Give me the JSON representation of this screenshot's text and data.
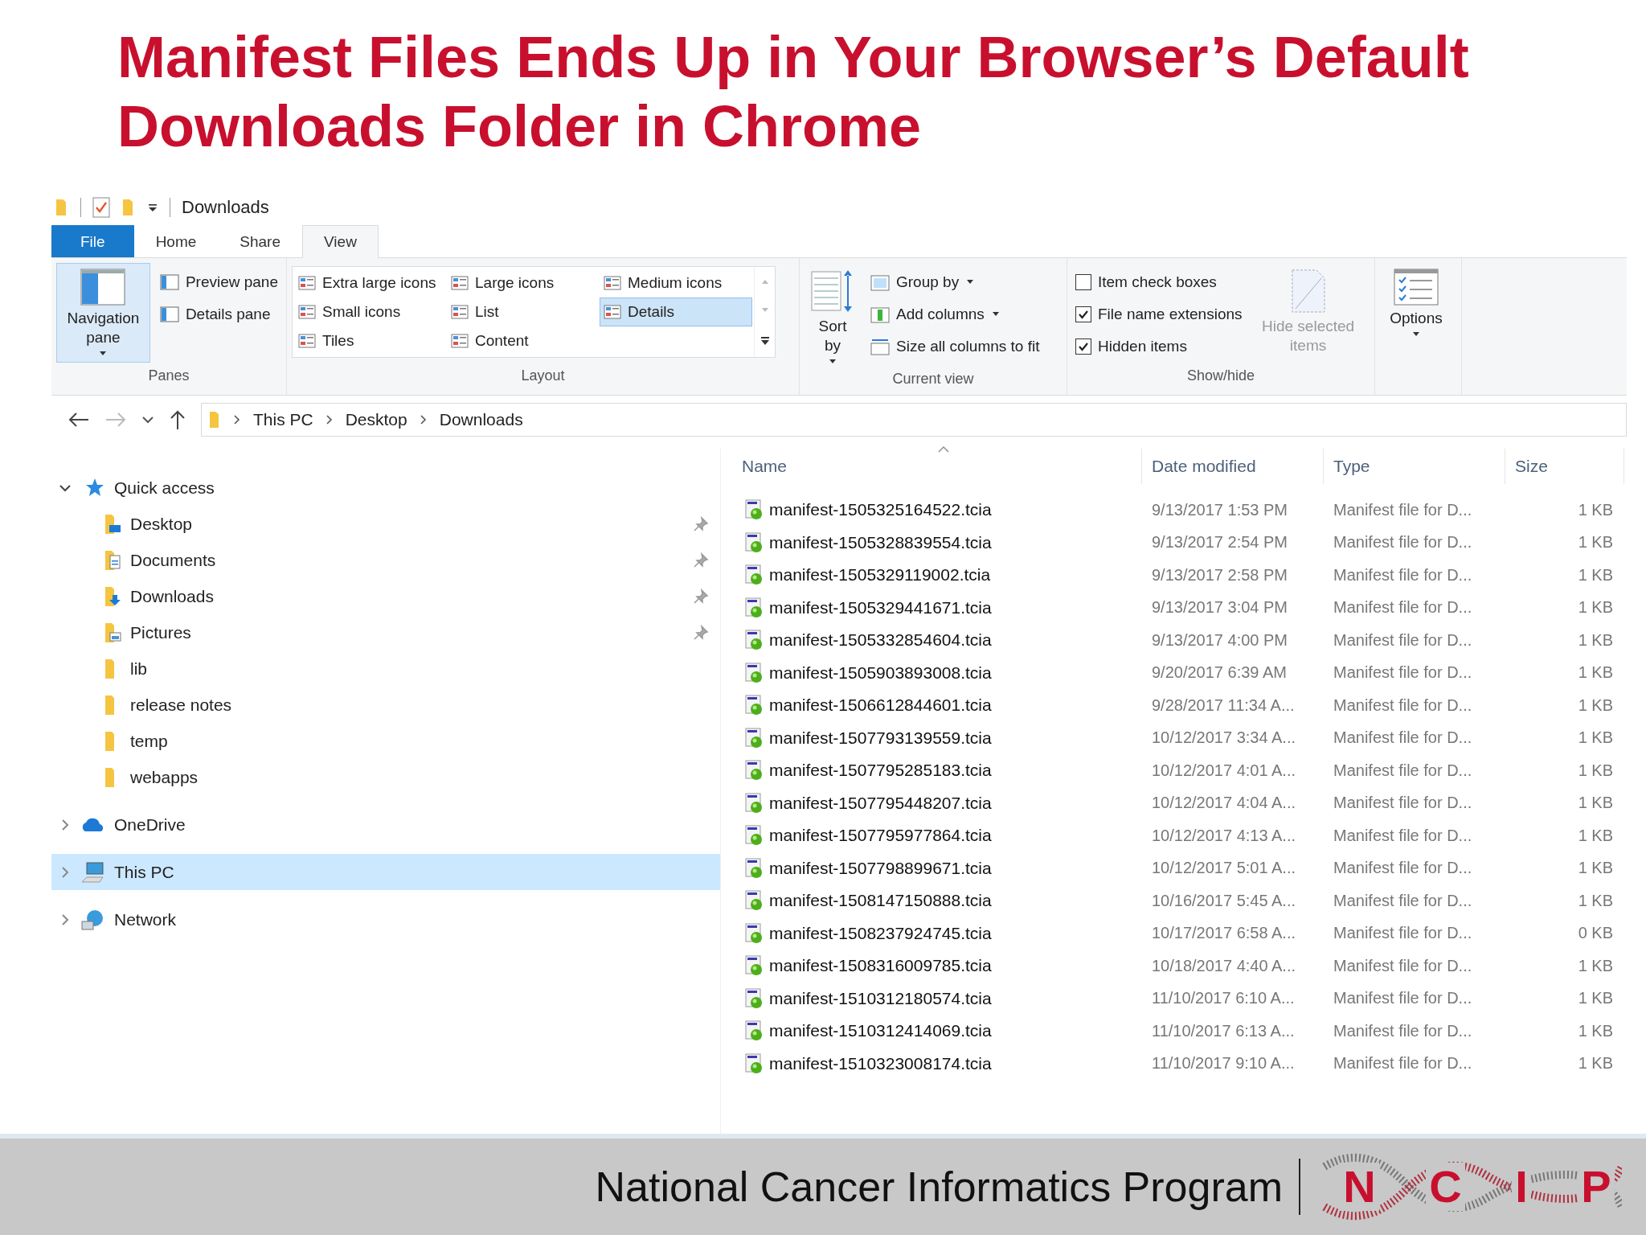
{
  "slide_title": "Manifest Files Ends Up in Your Browser’s Default Downloads Folder in Chrome",
  "window": {
    "title": "Downloads"
  },
  "ribbon_tabs": [
    {
      "label": "File",
      "kind": "file",
      "selected": false
    },
    {
      "label": "Home",
      "kind": "tab",
      "selected": false
    },
    {
      "label": "Share",
      "kind": "tab",
      "selected": false
    },
    {
      "label": "View",
      "kind": "tab",
      "selected": true
    }
  ],
  "panes_group": {
    "label": "Panes",
    "navigation_pane": {
      "label": "Navigation pane",
      "on": true
    },
    "items": [
      "Preview pane",
      "Details pane"
    ]
  },
  "layout_group": {
    "label": "Layout",
    "options": [
      {
        "label": "Extra large icons",
        "selected": false
      },
      {
        "label": "Large icons",
        "selected": false
      },
      {
        "label": "Medium icons",
        "selected": false
      },
      {
        "label": "Small icons",
        "selected": false
      },
      {
        "label": "List",
        "selected": false
      },
      {
        "label": "Details",
        "selected": true
      },
      {
        "label": "Tiles",
        "selected": false
      },
      {
        "label": "Content",
        "selected": false
      }
    ]
  },
  "current_view_group": {
    "label": "Current view",
    "sort_by": "Sort by",
    "items": [
      {
        "label": "Group by",
        "dropdown": true
      },
      {
        "label": "Add columns",
        "dropdown": true
      },
      {
        "label": "Size all columns to fit",
        "dropdown": false
      }
    ]
  },
  "show_hide_group": {
    "label": "Show/hide",
    "checkboxes": [
      {
        "label": "Item check boxes",
        "checked": false
      },
      {
        "label": "File name extensions",
        "checked": true
      },
      {
        "label": "Hidden items",
        "checked": true
      }
    ],
    "hide_selected": {
      "label": "Hide selected items",
      "disabled": true
    }
  },
  "options": {
    "label": "Options"
  },
  "address_bar": {
    "crumbs": [
      "This PC",
      "Desktop",
      "Downloads"
    ]
  },
  "navigation": [
    {
      "label": "Quick access",
      "kind": "quick-access",
      "expanded": true,
      "selected": false,
      "children": [
        {
          "label": "Desktop",
          "kind": "desktop",
          "pinned": true
        },
        {
          "label": "Documents",
          "kind": "documents",
          "pinned": true
        },
        {
          "label": "Downloads",
          "kind": "downloads",
          "pinned": true
        },
        {
          "label": "Pictures",
          "kind": "pictures",
          "pinned": true
        },
        {
          "label": "lib",
          "kind": "folder",
          "pinned": false
        },
        {
          "label": "release notes",
          "kind": "folder",
          "pinned": false
        },
        {
          "label": "temp",
          "kind": "folder",
          "pinned": false
        },
        {
          "label": "webapps",
          "kind": "folder",
          "pinned": false
        }
      ]
    },
    {
      "label": "OneDrive",
      "kind": "onedrive",
      "expanded": false,
      "selected": false
    },
    {
      "label": "This PC",
      "kind": "pc",
      "expanded": false,
      "selected": true
    },
    {
      "label": "Network",
      "kind": "network",
      "expanded": false,
      "selected": false
    }
  ],
  "table": {
    "columns": [
      {
        "label": "Name",
        "sorted": true
      },
      {
        "label": "Date modified",
        "sorted": false
      },
      {
        "label": "Type",
        "sorted": false
      },
      {
        "label": "Size",
        "sorted": false
      }
    ],
    "rows": [
      {
        "name": "manifest-1505325164522.tcia",
        "date": "9/13/2017 1:53 PM",
        "type": "Manifest file for D...",
        "size": "1 KB"
      },
      {
        "name": "manifest-1505328839554.tcia",
        "date": "9/13/2017 2:54 PM",
        "type": "Manifest file for D...",
        "size": "1 KB"
      },
      {
        "name": "manifest-1505329119002.tcia",
        "date": "9/13/2017 2:58 PM",
        "type": "Manifest file for D...",
        "size": "1 KB"
      },
      {
        "name": "manifest-1505329441671.tcia",
        "date": "9/13/2017 3:04 PM",
        "type": "Manifest file for D...",
        "size": "1 KB"
      },
      {
        "name": "manifest-1505332854604.tcia",
        "date": "9/13/2017 4:00 PM",
        "type": "Manifest file for D...",
        "size": "1 KB"
      },
      {
        "name": "manifest-1505903893008.tcia",
        "date": "9/20/2017 6:39 AM",
        "type": "Manifest file for D...",
        "size": "1 KB"
      },
      {
        "name": "manifest-1506612844601.tcia",
        "date": "9/28/2017 11:34 A...",
        "type": "Manifest file for D...",
        "size": "1 KB"
      },
      {
        "name": "manifest-1507793139559.tcia",
        "date": "10/12/2017 3:34 A...",
        "type": "Manifest file for D...",
        "size": "1 KB"
      },
      {
        "name": "manifest-1507795285183.tcia",
        "date": "10/12/2017 4:01 A...",
        "type": "Manifest file for D...",
        "size": "1 KB"
      },
      {
        "name": "manifest-1507795448207.tcia",
        "date": "10/12/2017 4:04 A...",
        "type": "Manifest file for D...",
        "size": "1 KB"
      },
      {
        "name": "manifest-1507795977864.tcia",
        "date": "10/12/2017 4:13 A...",
        "type": "Manifest file for D...",
        "size": "1 KB"
      },
      {
        "name": "manifest-1507798899671.tcia",
        "date": "10/12/2017 5:01 A...",
        "type": "Manifest file for D...",
        "size": "1 KB"
      },
      {
        "name": "manifest-1508147150888.tcia",
        "date": "10/16/2017 5:45 A...",
        "type": "Manifest file for D...",
        "size": "1 KB"
      },
      {
        "name": "manifest-1508237924745.tcia",
        "date": "10/17/2017 6:58 A...",
        "type": "Manifest file for D...",
        "size": "0 KB"
      },
      {
        "name": "manifest-1508316009785.tcia",
        "date": "10/18/2017 4:40 A...",
        "type": "Manifest file for D...",
        "size": "1 KB"
      },
      {
        "name": "manifest-1510312180574.tcia",
        "date": "11/10/2017 6:10 A...",
        "type": "Manifest file for D...",
        "size": "1 KB"
      },
      {
        "name": "manifest-1510312414069.tcia",
        "date": "11/10/2017 6:13 A...",
        "type": "Manifest file for D...",
        "size": "1 KB"
      },
      {
        "name": "manifest-1510323008174.tcia",
        "date": "11/10/2017 9:10 A...",
        "type": "Manifest file for D...",
        "size": "1 KB"
      }
    ]
  },
  "footer": {
    "text": "National Cancer Informatics Program",
    "logo_letters": [
      "N",
      "C",
      "I",
      "P"
    ]
  }
}
